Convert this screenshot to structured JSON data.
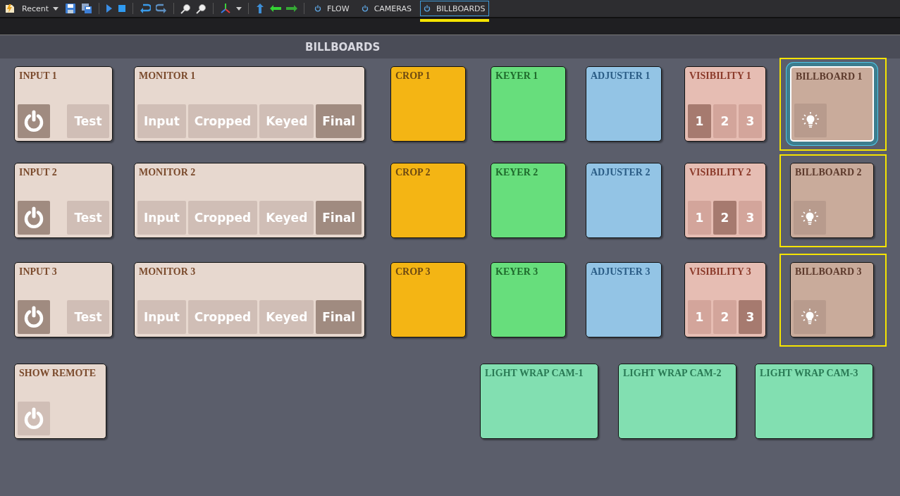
{
  "toolbar": {
    "recent_label": "Recent",
    "tabs": [
      {
        "label": "FLOW",
        "selected": false
      },
      {
        "label": "CAMERAS",
        "selected": false
      },
      {
        "label": "BILLBOARDS",
        "selected": true
      }
    ]
  },
  "section_title": "BILLBOARDS",
  "rows": [
    {
      "cards": [
        {
          "kind": "input",
          "title": "INPUT 1",
          "power_on": true,
          "button": "Test"
        },
        {
          "kind": "monitor",
          "title": "MONITOR 1",
          "options": [
            {
              "label": "Input",
              "selected": false
            },
            {
              "label": "Cropped",
              "selected": false
            },
            {
              "label": "Keyed",
              "selected": false
            },
            {
              "label": "Final",
              "selected": true
            }
          ]
        },
        {
          "kind": "crop",
          "title": "CROP 1"
        },
        {
          "kind": "keyer",
          "title": "KEYER 1"
        },
        {
          "kind": "adjuster",
          "title": "ADJUSTER 1"
        },
        {
          "kind": "visibility",
          "title": "VISIBILITY 1",
          "options": [
            {
              "label": "1",
              "selected": true
            },
            {
              "label": "2",
              "selected": false
            },
            {
              "label": "3",
              "selected": false
            }
          ]
        },
        {
          "kind": "billboard",
          "title": "BILLBOARD 1",
          "highlighted": true,
          "focused": true
        }
      ]
    },
    {
      "cards": [
        {
          "kind": "input",
          "title": "INPUT 2",
          "power_on": true,
          "button": "Test"
        },
        {
          "kind": "monitor",
          "title": "MONITOR 2",
          "options": [
            {
              "label": "Input",
              "selected": false
            },
            {
              "label": "Cropped",
              "selected": false
            },
            {
              "label": "Keyed",
              "selected": false
            },
            {
              "label": "Final",
              "selected": true
            }
          ]
        },
        {
          "kind": "crop",
          "title": "CROP 2"
        },
        {
          "kind": "keyer",
          "title": "KEYER 2"
        },
        {
          "kind": "adjuster",
          "title": "ADJUSTER 2"
        },
        {
          "kind": "visibility",
          "title": "VISIBILITY 2",
          "options": [
            {
              "label": "1",
              "selected": false
            },
            {
              "label": "2",
              "selected": true
            },
            {
              "label": "3",
              "selected": false
            }
          ]
        },
        {
          "kind": "billboard",
          "title": "BILLBOARD 2",
          "highlighted": true,
          "focused": false
        }
      ]
    },
    {
      "cards": [
        {
          "kind": "input",
          "title": "INPUT 3",
          "power_on": true,
          "button": "Test"
        },
        {
          "kind": "monitor",
          "title": "MONITOR 3",
          "options": [
            {
              "label": "Input",
              "selected": false
            },
            {
              "label": "Cropped",
              "selected": false
            },
            {
              "label": "Keyed",
              "selected": false
            },
            {
              "label": "Final",
              "selected": true
            }
          ]
        },
        {
          "kind": "crop",
          "title": "CROP 3"
        },
        {
          "kind": "keyer",
          "title": "KEYER 3"
        },
        {
          "kind": "adjuster",
          "title": "ADJUSTER 3"
        },
        {
          "kind": "visibility",
          "title": "VISIBILITY 3",
          "options": [
            {
              "label": "1",
              "selected": false
            },
            {
              "label": "2",
              "selected": false
            },
            {
              "label": "3",
              "selected": true
            }
          ]
        },
        {
          "kind": "billboard",
          "title": "BILLBOARD 3",
          "highlighted": true,
          "focused": false
        }
      ]
    }
  ],
  "bottom_row": {
    "cards": [
      {
        "kind": "remote",
        "title": "SHOW REMOTE",
        "power_on": false
      },
      {
        "kind": "lightwrap",
        "title": "LIGHT WRAP CAM-1"
      },
      {
        "kind": "lightwrap",
        "title": "LIGHT WRAP CAM-2"
      },
      {
        "kind": "lightwrap",
        "title": "LIGHT WRAP CAM-3"
      }
    ]
  }
}
